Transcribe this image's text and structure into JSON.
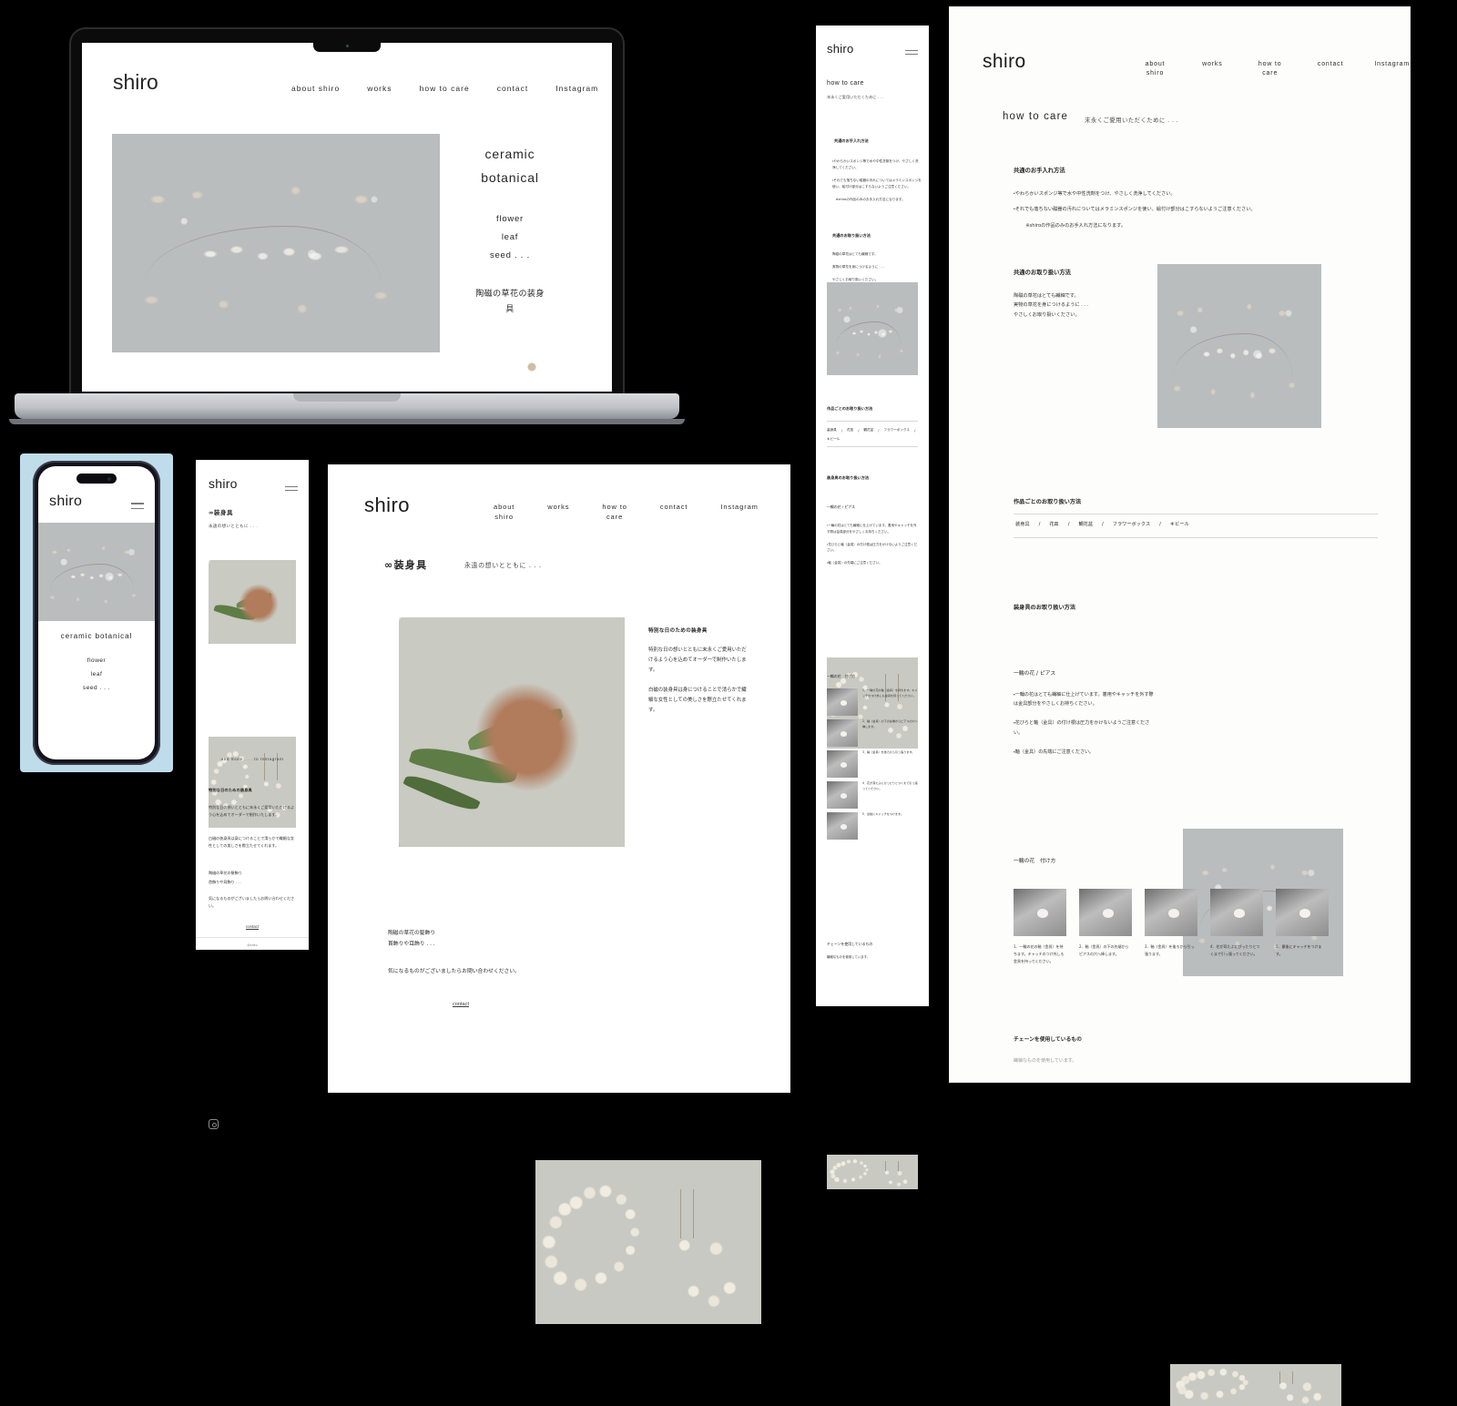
{
  "site": {
    "brand": "shiro",
    "nav": [
      "about shiro",
      "works",
      "how to care",
      "contact",
      "Instagram"
    ],
    "nav_wrapped": [
      "about\nshiro",
      "works",
      "how to\ncare",
      "contact",
      "Instagram"
    ]
  },
  "home": {
    "hero": {
      "title_line1": "ceramic",
      "title_line2": "botanical",
      "title_inline": "ceramic botanical",
      "list": [
        "flower",
        "leaf",
        "seed . . ."
      ],
      "jp_line1": "陶磁の草花の装身",
      "jp_line2": "具"
    }
  },
  "works": {
    "heading": "∞装身具",
    "subheading": "永遠の想いとともに . . .",
    "side": {
      "title": "特別な日のための装身具",
      "p1": "特別な日の想いとともに末永くご愛用いただけるよう心を込めてオーダーで制作いたします。",
      "p2": "白磁の装身具は身につけることで清らかで繊細な女性としての美しさを際立たせてくれます。"
    },
    "footer": {
      "line1": "陶磁の草花の髪飾り",
      "line2": "首飾りや耳飾り . . .",
      "p": "気になるものがございましたらお問い合わせください。",
      "contact_link": "contact"
    },
    "mobile": {
      "and_more": "and more . . . to Instagram",
      "footer_ig_label": "@shiro"
    }
  },
  "care": {
    "heading": "how to care",
    "subheading": "末永くご愛用いただくために . . .",
    "sections": [
      {
        "title": "共通のお手入れ方法",
        "bullets": [
          "・やわらかいスポンジ等で水や中性洗剤をつけ、やさしく洗浄してください。",
          "・それでも落ちない磁器の汚れについてはメラミンスポンジを使い、絵付け部分はこすらないようご注意ください。",
          "　※shiroの作品のみのお手入れ方法になります。"
        ]
      },
      {
        "title": "共通のお取り扱い方法",
        "bullets": [
          "陶磁の草花はとても繊細です。",
          "実物の草花を身につけるように . . .",
          "やさしくお取り扱いください。"
        ]
      }
    ],
    "tabs_title": "作品ごとのお取り扱い方法",
    "tabs": [
      "装身具",
      "花皿",
      "観花盆",
      "フラワーボックス",
      "キビール"
    ],
    "item_section_title": "装身具のお取り扱い方法",
    "item_subtitle": "一輪の花 / ピアス",
    "item_bullets": [
      "・一輪の花はとても繊細に仕上げています。着用やキャッチを外す際は金具部分をやさしくお持ちください。",
      "・花びらと軸（金具）の付け根は圧力をかけないようご注意ください。",
      "・軸（金具）の先端にご注意ください。"
    ],
    "steps_title": "一輪の花　付け方",
    "steps": [
      "1．一輪の花の軸（金具）を持ちます。キャッチのつけ外しも金具を持ってください。",
      "2．軸（金具）の下の先端からピアスの穴へ挿します。",
      "3．軸（金具）を後ろから引っ張ります。",
      "4．花が耳たぶにぴったりとつくまで引っ張ってください。",
      "5．最後にキャッチをつけます。"
    ],
    "chain_title": "チェーンを使用しているもの",
    "chain_sub": "繊細なものを使用しています。"
  },
  "colors": {
    "page_bg": "#ffffff",
    "canvas_bg": "#000000",
    "text": "#262626",
    "muted": "#7a7a7a",
    "rule": "#d8d8d8",
    "phone_accent": "#bfdcea"
  }
}
